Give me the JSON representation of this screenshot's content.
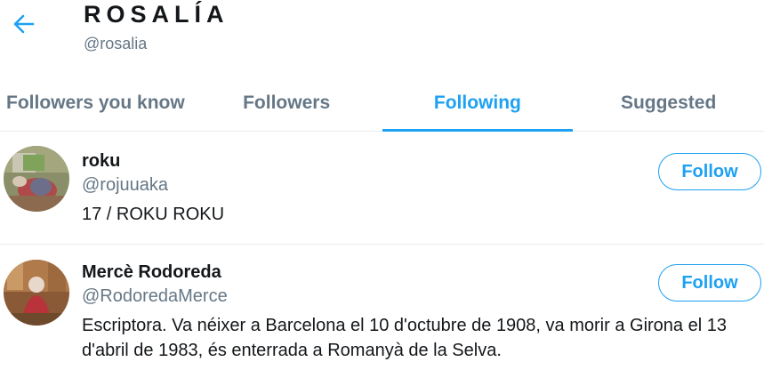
{
  "header": {
    "back_icon": "arrow-left-icon",
    "title": "ROSALÍA",
    "handle": "@rosalia"
  },
  "tabs": [
    {
      "label": "Followers you know",
      "active": false
    },
    {
      "label": "Followers",
      "active": false
    },
    {
      "label": "Following",
      "active": true
    },
    {
      "label": "Suggested",
      "active": false
    }
  ],
  "users": [
    {
      "name": "roku",
      "handle": "@rojuuaka",
      "bio": "17 / ROKU ROKU",
      "follow_label": "Follow"
    },
    {
      "name": "Mercè Rodoreda",
      "handle": "@RodoredaMerce",
      "bio": "Escriptora. Va néixer a Barcelona el 10 d'octubre de 1908, va morir a Girona el 13 d'abril de 1983, és enterrada a Romanyà de la Selva.",
      "follow_label": "Follow"
    }
  ],
  "colors": {
    "accent": "#1da1f2",
    "secondary_text": "#657786",
    "primary_text": "#14171a",
    "divider": "#e6ecf0"
  }
}
